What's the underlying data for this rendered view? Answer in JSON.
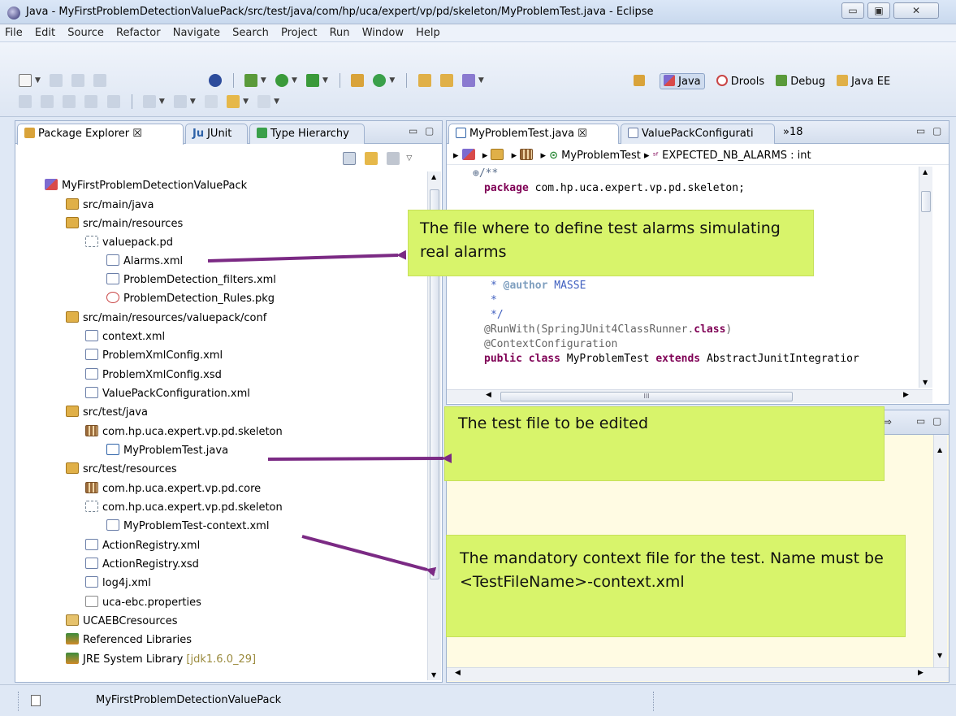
{
  "window": {
    "title": "Java - MyFirstProblemDetectionValuePack/src/test/java/com/hp/uca/expert/vp/pd/skeleton/MyProblemTest.java - Eclipse",
    "minimize": "▭",
    "maximize": "▣",
    "close": "✕"
  },
  "menu": [
    "File",
    "Edit",
    "Source",
    "Refactor",
    "Navigate",
    "Search",
    "Project",
    "Run",
    "Window",
    "Help"
  ],
  "perspectives": {
    "java": "Java",
    "drools": "Drools",
    "debug": "Debug",
    "javaee": "Java EE"
  },
  "left_panel": {
    "tabs": [
      "Package Explorer ☒",
      "JUnit",
      "Type Hierarchy"
    ],
    "junit_prefix": "Ju",
    "tree": [
      {
        "label": "MyFirstProblemDetectionValuePack",
        "icon": "project-icon"
      },
      {
        "label": "src/main/java",
        "icon": "source-folder-icon"
      },
      {
        "label": "src/main/resources",
        "icon": "source-folder-icon"
      },
      {
        "label": "valuepack.pd",
        "icon": "package-icon"
      },
      {
        "label": "Alarms.xml",
        "icon": "xml-file-icon"
      },
      {
        "label": "ProblemDetection_filters.xml",
        "icon": "xml-file-icon"
      },
      {
        "label": "ProblemDetection_Rules.pkg",
        "icon": "drools-file-icon"
      },
      {
        "label": "src/main/resources/valuepack/conf",
        "icon": "source-folder-icon"
      },
      {
        "label": "context.xml",
        "icon": "xml-file-icon"
      },
      {
        "label": "ProblemXmlConfig.xml",
        "icon": "xml-file-icon"
      },
      {
        "label": "ProblemXmlConfig.xsd",
        "icon": "xsd-file-icon"
      },
      {
        "label": "ValuePackConfiguration.xml",
        "icon": "xml-file-icon"
      },
      {
        "label": "src/test/java",
        "icon": "source-folder-icon"
      },
      {
        "label": "com.hp.uca.expert.vp.pd.skeleton",
        "icon": "package-icon"
      },
      {
        "label": "MyProblemTest.java",
        "icon": "java-file-icon"
      },
      {
        "label": "src/test/resources",
        "icon": "source-folder-icon"
      },
      {
        "label": "com.hp.uca.expert.vp.pd.core",
        "icon": "package-icon"
      },
      {
        "label": "com.hp.uca.expert.vp.pd.skeleton",
        "icon": "empty-package-icon"
      },
      {
        "label": "MyProblemTest-context.xml",
        "icon": "xml-file-icon"
      },
      {
        "label": "ActionRegistry.xml",
        "icon": "xml-file-icon"
      },
      {
        "label": "ActionRegistry.xsd",
        "icon": "xsd-file-icon"
      },
      {
        "label": "log4j.xml",
        "icon": "xml-file-icon"
      },
      {
        "label": "uca-ebc.properties",
        "icon": "properties-file-icon"
      },
      {
        "label": "UCAEBCresources",
        "icon": "folder-icon"
      },
      {
        "label": "Referenced Libraries",
        "icon": "library-icon"
      },
      {
        "label": "JRE System Library",
        "icon": "library-icon",
        "suffix": "[jdk1.6.0_29]"
      }
    ]
  },
  "editor": {
    "tabs": [
      "MyProblemTest.java ☒",
      "ValuePackConfigurati"
    ],
    "overflow": "»18",
    "breadcrumb": {
      "class": "MyProblemTest",
      "field": "EXPECTED_NB_ALARMS : int"
    },
    "code": {
      "fold": "⊕/**",
      "package_kw": "package",
      "package_name": " com.hp.uca.expert.vp.pd.skeleton;",
      "author_tag": "@author",
      "author_name": " MASSE",
      "star": "*",
      "end_comment": "*/",
      "runwith": "@RunWith(SpringJUnit4ClassRunner.",
      "class_kw": "class",
      "runwith_end": ")",
      "contextconf": "@ContextConfiguration",
      "public_kw": "public",
      "class_kw2": "class",
      "classname": " MyProblemTest ",
      "extends_kw": "extends",
      "superclass": " AbstractJunitIntegratior"
    },
    "hscroll_mark": "III"
  },
  "callouts": {
    "alarms": "The file where to define test alarms simulating real alarms",
    "testfile": "The test file to be edited",
    "context": "The mandatory context file for the test. Name must be <TestFileName>-context.xml"
  },
  "status": {
    "project": "MyFirstProblemDetectionValuePack"
  },
  "colors": {
    "callout": "#d8f46b",
    "arrow": "#7b2a84",
    "bottom_pane": "#fffbe3"
  }
}
